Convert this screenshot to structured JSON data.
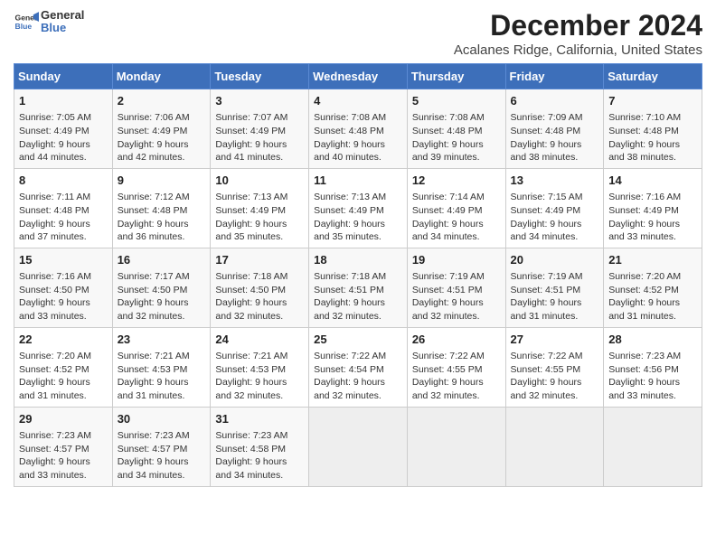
{
  "logo": {
    "line1": "General",
    "line2": "Blue"
  },
  "title": "December 2024",
  "subtitle": "Acalanes Ridge, California, United States",
  "days_of_week": [
    "Sunday",
    "Monday",
    "Tuesday",
    "Wednesday",
    "Thursday",
    "Friday",
    "Saturday"
  ],
  "weeks": [
    [
      {
        "day": 1,
        "info": "Sunrise: 7:05 AM\nSunset: 4:49 PM\nDaylight: 9 hours\nand 44 minutes."
      },
      {
        "day": 2,
        "info": "Sunrise: 7:06 AM\nSunset: 4:49 PM\nDaylight: 9 hours\nand 42 minutes."
      },
      {
        "day": 3,
        "info": "Sunrise: 7:07 AM\nSunset: 4:49 PM\nDaylight: 9 hours\nand 41 minutes."
      },
      {
        "day": 4,
        "info": "Sunrise: 7:08 AM\nSunset: 4:48 PM\nDaylight: 9 hours\nand 40 minutes."
      },
      {
        "day": 5,
        "info": "Sunrise: 7:08 AM\nSunset: 4:48 PM\nDaylight: 9 hours\nand 39 minutes."
      },
      {
        "day": 6,
        "info": "Sunrise: 7:09 AM\nSunset: 4:48 PM\nDaylight: 9 hours\nand 38 minutes."
      },
      {
        "day": 7,
        "info": "Sunrise: 7:10 AM\nSunset: 4:48 PM\nDaylight: 9 hours\nand 38 minutes."
      }
    ],
    [
      {
        "day": 8,
        "info": "Sunrise: 7:11 AM\nSunset: 4:48 PM\nDaylight: 9 hours\nand 37 minutes."
      },
      {
        "day": 9,
        "info": "Sunrise: 7:12 AM\nSunset: 4:48 PM\nDaylight: 9 hours\nand 36 minutes."
      },
      {
        "day": 10,
        "info": "Sunrise: 7:13 AM\nSunset: 4:49 PM\nDaylight: 9 hours\nand 35 minutes."
      },
      {
        "day": 11,
        "info": "Sunrise: 7:13 AM\nSunset: 4:49 PM\nDaylight: 9 hours\nand 35 minutes."
      },
      {
        "day": 12,
        "info": "Sunrise: 7:14 AM\nSunset: 4:49 PM\nDaylight: 9 hours\nand 34 minutes."
      },
      {
        "day": 13,
        "info": "Sunrise: 7:15 AM\nSunset: 4:49 PM\nDaylight: 9 hours\nand 34 minutes."
      },
      {
        "day": 14,
        "info": "Sunrise: 7:16 AM\nSunset: 4:49 PM\nDaylight: 9 hours\nand 33 minutes."
      }
    ],
    [
      {
        "day": 15,
        "info": "Sunrise: 7:16 AM\nSunset: 4:50 PM\nDaylight: 9 hours\nand 33 minutes."
      },
      {
        "day": 16,
        "info": "Sunrise: 7:17 AM\nSunset: 4:50 PM\nDaylight: 9 hours\nand 32 minutes."
      },
      {
        "day": 17,
        "info": "Sunrise: 7:18 AM\nSunset: 4:50 PM\nDaylight: 9 hours\nand 32 minutes."
      },
      {
        "day": 18,
        "info": "Sunrise: 7:18 AM\nSunset: 4:51 PM\nDaylight: 9 hours\nand 32 minutes."
      },
      {
        "day": 19,
        "info": "Sunrise: 7:19 AM\nSunset: 4:51 PM\nDaylight: 9 hours\nand 32 minutes."
      },
      {
        "day": 20,
        "info": "Sunrise: 7:19 AM\nSunset: 4:51 PM\nDaylight: 9 hours\nand 31 minutes."
      },
      {
        "day": 21,
        "info": "Sunrise: 7:20 AM\nSunset: 4:52 PM\nDaylight: 9 hours\nand 31 minutes."
      }
    ],
    [
      {
        "day": 22,
        "info": "Sunrise: 7:20 AM\nSunset: 4:52 PM\nDaylight: 9 hours\nand 31 minutes."
      },
      {
        "day": 23,
        "info": "Sunrise: 7:21 AM\nSunset: 4:53 PM\nDaylight: 9 hours\nand 31 minutes."
      },
      {
        "day": 24,
        "info": "Sunrise: 7:21 AM\nSunset: 4:53 PM\nDaylight: 9 hours\nand 32 minutes."
      },
      {
        "day": 25,
        "info": "Sunrise: 7:22 AM\nSunset: 4:54 PM\nDaylight: 9 hours\nand 32 minutes."
      },
      {
        "day": 26,
        "info": "Sunrise: 7:22 AM\nSunset: 4:55 PM\nDaylight: 9 hours\nand 32 minutes."
      },
      {
        "day": 27,
        "info": "Sunrise: 7:22 AM\nSunset: 4:55 PM\nDaylight: 9 hours\nand 32 minutes."
      },
      {
        "day": 28,
        "info": "Sunrise: 7:23 AM\nSunset: 4:56 PM\nDaylight: 9 hours\nand 33 minutes."
      }
    ],
    [
      {
        "day": 29,
        "info": "Sunrise: 7:23 AM\nSunset: 4:57 PM\nDaylight: 9 hours\nand 33 minutes."
      },
      {
        "day": 30,
        "info": "Sunrise: 7:23 AM\nSunset: 4:57 PM\nDaylight: 9 hours\nand 34 minutes."
      },
      {
        "day": 31,
        "info": "Sunrise: 7:23 AM\nSunset: 4:58 PM\nDaylight: 9 hours\nand 34 minutes."
      },
      null,
      null,
      null,
      null
    ]
  ]
}
